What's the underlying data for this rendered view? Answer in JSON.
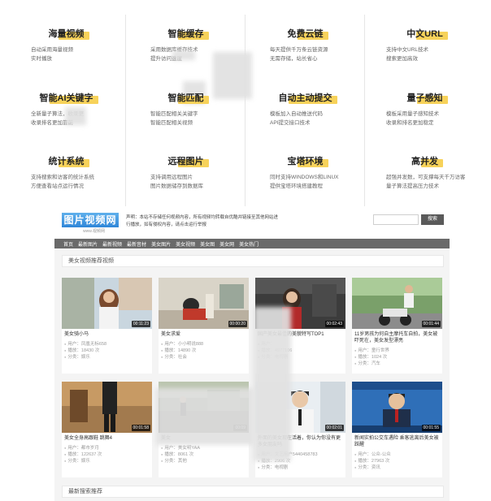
{
  "features": [
    {
      "title": "海量视频",
      "desc": [
        "自动采用海量视频",
        "实时播放"
      ]
    },
    {
      "title": "智能缓存",
      "desc": [
        "采用数据库缓存技术",
        "提升访问速度"
      ]
    },
    {
      "title": "免费云链",
      "desc": [
        "每天提供千万条云链资源",
        "无需存储，站长省心"
      ]
    },
    {
      "title": "中文URL",
      "desc": [
        "支持中文URL技术",
        "搜索更加高效"
      ]
    },
    {
      "title": "智能AI关键字",
      "desc": [
        "全新量子算法，收录更",
        "收录排名更加靠前"
      ]
    },
    {
      "title": "智能匹配",
      "desc": [
        "智能匹配相关关键字",
        "智能匹配相关视频"
      ]
    },
    {
      "title": "自动主动提交",
      "desc": [
        "模板加入自动推送代码",
        "API提交接口技术"
      ]
    },
    {
      "title": "量子感知",
      "desc": [
        "模板采用量子感知技术",
        "收录和排名更加稳定"
      ]
    },
    {
      "title": "统计系统",
      "desc": [
        "支持搜索和访客的统计系统",
        "方便查看站点运行情况"
      ]
    },
    {
      "title": "远程图片",
      "desc": [
        "支持调用远程图片",
        "图片数据储存到数据库"
      ]
    },
    {
      "title": "宝塔环境",
      "desc": [
        "同时支持WINDOWS和LINUX",
        "提供宝塔环境搭建教程"
      ]
    },
    {
      "title": "高并发",
      "desc": [
        "超强并发数，可支撑每天千万访客",
        "量子算法提高压力技术"
      ]
    }
  ],
  "site": {
    "logo": "图片视频网",
    "logo_sub": "www.视频网",
    "notice": "声明：本站不存储任何视频内容，所有视频均转载自优酷并链接至其他网站进行播放，如有侵权内容，请点击运行举报",
    "search_placeholder": "",
    "search_button": "搜索",
    "nav": [
      "首页",
      "最新图片",
      "最新视频",
      "最新音材",
      "美女图片",
      "美女视频",
      "美女图",
      "美女网",
      "美女热门"
    ],
    "section_title": "美女视频推荐视频",
    "bottom_title": "最新搜索推荐"
  },
  "cards": [
    {
      "title": "美女骑小马",
      "duration": "00:11:23",
      "user": "用户：凤凰无标658",
      "plays": "播放：18430 次",
      "cat": "分类：娱乐",
      "thumb": "t1"
    },
    {
      "title": "美女求爱",
      "duration": "00:00:20",
      "user": "用户：小小明说888",
      "plays": "播放：14890 次",
      "cat": "分类：社会",
      "thumb": "t2"
    },
    {
      "title": "国产美女最佳的美貌特写TOP1",
      "duration": "00:02:43",
      "user": "用户：",
      "plays": "播放：4977106",
      "cat": "分类：电视剧",
      "thumb": "t3"
    },
    {
      "title": "11岁男孩为何自主摩托车自拍，美女被吓死在，美女发型漂亮",
      "duration": "00:01:44",
      "user": "用户：童行世界",
      "plays": "播放：1024 次",
      "cat": "分类：汽车",
      "thumb": "t4"
    },
    {
      "title": "美女全身高跟鞋 跳舞4",
      "duration": "00:01:58",
      "user": "用户：都市岁月",
      "plays": "播放：122637 次",
      "cat": "分类：娱乐",
      "thumb": "t5"
    },
    {
      "title": "美女",
      "duration": "00:09",
      "user": "用户：美女明YAA",
      "plays": "播放：8061 次",
      "cat": "分类：其他",
      "thumb": "t6"
    },
    {
      "title": "外面的美女现在活着，你认为你没有更多女朋友吗",
      "duration": "00:02:01",
      "user": "用户：文艺用户5440458783",
      "plays": "播放：2906 次",
      "cat": "分类：电视剧",
      "thumb": "t7"
    },
    {
      "title": "新闻实拍公交车遇险 乘客逃离后美女被踩醒",
      "duration": "00:01:55",
      "user": "用户：公众-公众",
      "plays": "播放：27963 次",
      "cat": "分类：资讯",
      "thumb": "t8"
    }
  ]
}
